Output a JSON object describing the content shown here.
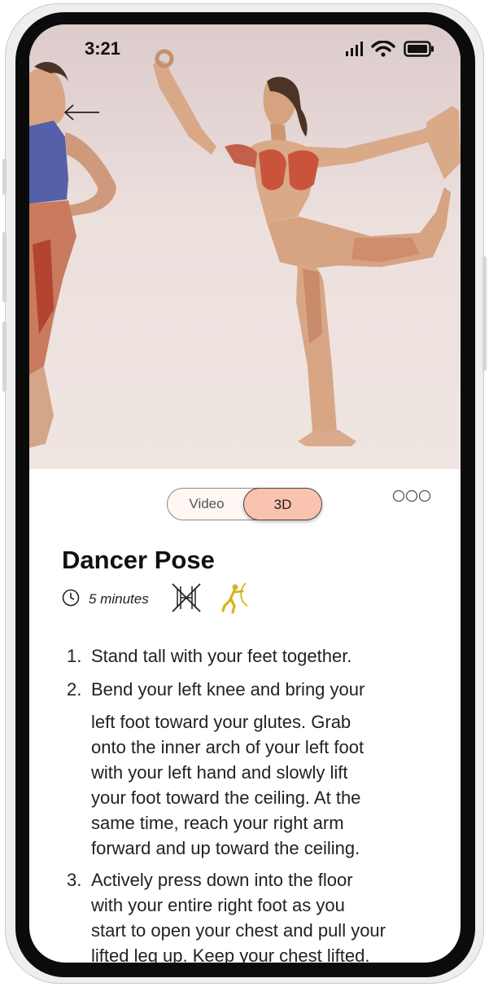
{
  "status_bar": {
    "time": "3:21"
  },
  "media_toggle": {
    "video_label": "Video",
    "threed_label": "3D",
    "selected": "3D"
  },
  "pose": {
    "title": "Dancer Pose",
    "duration": "5 minutes",
    "equipment_icon": "no-equipment-icon",
    "level_icon": "stretch-figure-icon"
  },
  "colors": {
    "accent": "#f9c3b0",
    "level_icon": "#d6b41a"
  },
  "steps": [
    {
      "number": "1.",
      "lines": [
        "Stand tall with your feet together."
      ]
    },
    {
      "number": "2.",
      "lines": [
        "Bend your left knee and bring your",
        "left foot toward your glutes. Grab",
        "onto the inner arch of your left foot",
        "with your left hand and slowly lift",
        "your foot toward the ceiling. At the",
        "same time, reach your right arm",
        "forward and up toward the ceiling."
      ]
    },
    {
      "number": "3.",
      "lines": [
        "Actively press down into the floor",
        "with your entire right foot as you",
        "start to open your chest and pull your",
        "lifted leg up. Keep your chest lifted."
      ]
    }
  ]
}
